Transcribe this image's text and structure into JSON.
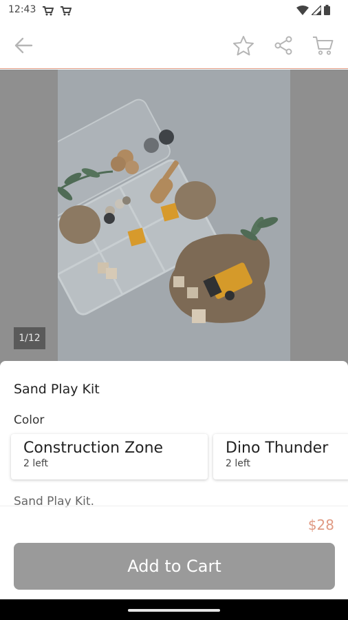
{
  "status_bar": {
    "time": "12:43",
    "icons": [
      "cart-notification-icon",
      "cart-notification-icon",
      "wifi-icon",
      "signal-icon",
      "battery-icon"
    ]
  },
  "app_bar": {
    "icons": [
      "back-arrow-icon",
      "star-icon",
      "share-icon",
      "cart-icon"
    ],
    "accent_color": "#e09a83"
  },
  "gallery": {
    "page_indicator": "1/12"
  },
  "product": {
    "title": "Sand Play Kit",
    "color_label": "Color",
    "options": [
      {
        "name": "Construction Zone",
        "stock": "2 left"
      },
      {
        "name": "Dino Thunder",
        "stock": "2 left"
      }
    ],
    "description": "Sand Play Kit.",
    "price": "$28",
    "add_to_cart_label": "Add to Cart"
  },
  "colors": {
    "price": "#e09a83",
    "button": "#9a9a9a"
  }
}
